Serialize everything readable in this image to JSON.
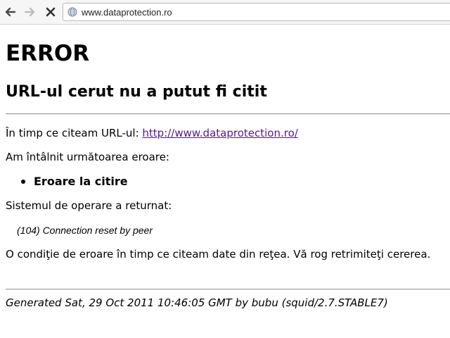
{
  "browser": {
    "url": "www.dataprotection.ro",
    "icons": {
      "back": "arrow-left-icon",
      "forward": "arrow-right-icon",
      "stop": "close-icon",
      "site": "globe-icon"
    }
  },
  "page": {
    "heading": "ERROR",
    "subheading": "URL-ul cerut nu a putut fi citit",
    "reading_prefix": "În timp ce citeam URL-ul: ",
    "reading_link": "http://www.dataprotection.ro/",
    "encountered": "Am întâlnit următoarea eroare:",
    "error_item": "Eroare la citire",
    "os_returned": "Sistemul de operare a returnat:",
    "error_detail": "(104) Connection reset by peer",
    "explanation": "O condiţie de eroare în timp ce citeam date din reţea. Vă rog retrimiteţi cererea.",
    "footer": "Generated Sat, 29 Oct 2011 10:46:05 GMT by bubu (squid/2.7.STABLE7)"
  },
  "colors": {
    "link": "#551a8b",
    "toolbar_bg": "#f6f6f6"
  }
}
